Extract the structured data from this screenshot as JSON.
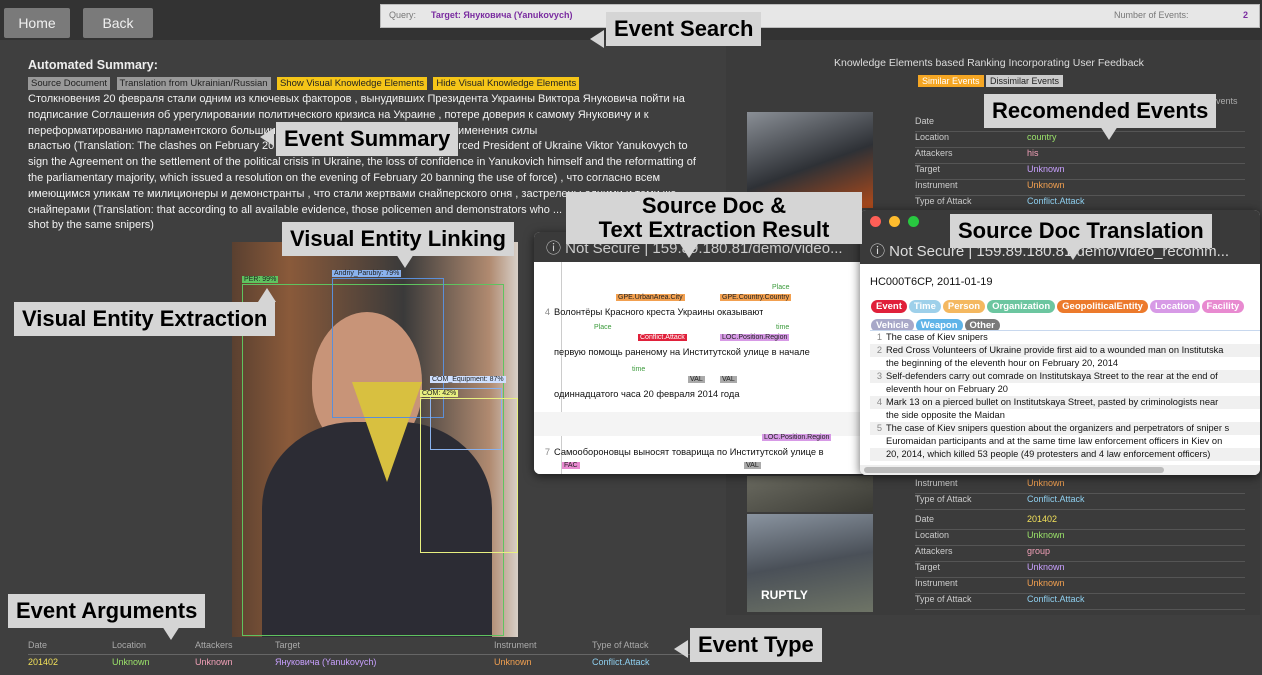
{
  "nav": {
    "home": "Home",
    "back": "Back"
  },
  "query": {
    "label": "Query:",
    "target": "Target: Януковича (Yanukovych)",
    "num_label": "Number of Events:",
    "num_value": "2"
  },
  "callouts": {
    "event_search": "Event Search",
    "event_summary": "Event Summary",
    "recommended": "Recomended Events",
    "source_doc": "Source Doc &",
    "text_extraction": "Text Extraction Result",
    "source_translation": "Source Doc Translation",
    "visual_linking": "Visual Entity Linking",
    "visual_extraction": "Visual Entity Extraction",
    "event_arguments": "Event Arguments",
    "event_type": "Event Type"
  },
  "summary": {
    "heading": "Automated Summary:",
    "buttons": [
      "Source Document",
      "Translation from Ukrainian/Russian",
      "Show Visual Knowledge Elements",
      "Hide Visual Knowledge Elements"
    ],
    "lines": [
      "Столкновения 20 февраля стали одним из ключевых факторов , вынудивших Президента Украины Виктора Януковича пойти на",
      "подписание Соглашения об урегулировании политического кризиса на Украине , потере доверия к самому Януковичу и к",
      "переформатированию парламентского большинства ... постановление о запрете применения силы",
      "властью (Translation: The clashes on February 20 became one of the key factors that forced President of Ukraine Viktor Yanukovych to",
      "sign the Agreement on the settlement of the political crisis in Ukraine, the loss of confidence in Yanukovich himself and the reformatting of",
      "the parliamentary majority, which issued a resolution on the evening of February 20 banning the use of force) , что согласно всем",
      "имеющимся уликам те милиционеры и демонстранты , что стали жертвами снайперского огня , застрелены одними и теми же",
      "снайперами (Translation: that according to all available evidence, those policemen and demonstrators who ...",
      "shot by the same snipers)"
    ]
  },
  "photo_boxes": [
    {
      "label": "PER: 99%"
    },
    {
      "label": "Andriy_Parubiy: 79%"
    },
    {
      "label": "COM_Equipment: 87%"
    },
    {
      "label": "COM: 42%"
    }
  ],
  "args": {
    "headers": [
      "Date",
      "Location",
      "Attackers",
      "Target",
      "Instrument",
      "Type of Attack"
    ],
    "values": [
      "201402",
      "Unknown",
      "Unknown",
      "Януковича (Yanukovych)",
      "Unknown",
      "Conflict.Attack"
    ]
  },
  "recommend": {
    "title": "Knowledge Elements based Ranking Incorporating User Feedback",
    "tabs": [
      "Similar Events",
      "Dissimilar Events"
    ],
    "tab_hint": "Events",
    "thumb_caption": "RUPTLY",
    "rows": [
      {
        "Date": "",
        "Location": "country",
        "Attackers": "his",
        "Target": "Unknown",
        "Instrument": "Unknown",
        "Type of Attack": "Conflict.Attack"
      },
      {
        "Instrument": "Unknown",
        "Type of Attack": "Conflict.Attack"
      },
      {
        "Date": "201402",
        "Location": "Unknown",
        "Attackers": "group",
        "Target": "Unknown",
        "Instrument": "Unknown",
        "Type of Attack": "Conflict.Attack"
      }
    ],
    "keys": [
      "Date",
      "Location",
      "Attackers",
      "Target",
      "Instrument",
      "Type of Attack"
    ]
  },
  "source_win": {
    "url_prefix": "ⓘ  Not Secure  |  159.89.180.81/demo/video...",
    "lines": [
      {
        "n": "4",
        "text": "Волонтёры      Красного      креста      Украины      оказывают"
      },
      {
        "n": "",
        "text": "первую помощь  раненому  на Институтской улице в начале"
      },
      {
        "n": "",
        "text": "одиннадцатого часа 20 февраля 2014 года"
      },
      {
        "n": "7",
        "text": "Самообороновцы выносят товарища по Институтской улице в"
      }
    ],
    "tags": [
      "GPE.UrbanArea.City",
      "GPE.Country.Country",
      "Place",
      "Conflict.Attack",
      "Place",
      "LOC.Position.Region",
      "time",
      "time",
      "VAL",
      "VAL",
      "LOC.Position.Region",
      "FAC",
      "VAL"
    ]
  },
  "trans_win": {
    "url": "ⓘ  Not Secure  |  159.89.180.81/demo/video_recomm...",
    "doc_id": "HC000T6CP,   2011-01-19",
    "chips": [
      {
        "label": "Event",
        "color": "#e0203a"
      },
      {
        "label": "Time",
        "color": "#9ed0ea"
      },
      {
        "label": "Person",
        "color": "#f4b860"
      },
      {
        "label": "Organization",
        "color": "#6cc6a0"
      },
      {
        "label": "GeopoliticalEntity",
        "color": "#ec7a2c"
      },
      {
        "label": "Location",
        "color": "#d79ae6"
      },
      {
        "label": "Facility",
        "color": "#e88ad0"
      },
      {
        "label": "Vehicle",
        "color": "#a8a8c8"
      },
      {
        "label": "Weapon",
        "color": "#5fb4e8"
      },
      {
        "label": "Other",
        "color": "#7a7a7a"
      }
    ],
    "lines": [
      {
        "n": "1",
        "text": "The case of Kiev snipers"
      },
      {
        "n": "2",
        "text": "Red Cross Volunteers of Ukraine provide first aid to a wounded man on Institutska"
      },
      {
        "n": "",
        "text": "the beginning of the eleventh hour on February 20, 2014"
      },
      {
        "n": "3",
        "text": "Self-defenders carry out comrade on Institutskaya Street to the rear at the end of"
      },
      {
        "n": "",
        "text": "eleventh hour on February 20"
      },
      {
        "n": "4",
        "text": "Mark 13 on a pierced bullet on Institutskaya Street, pasted by criminologists near"
      },
      {
        "n": "",
        "text": "the side opposite the Maidan"
      },
      {
        "n": "5",
        "text": "The case of Kiev snipers question about the organizers and perpetrators of sniper s"
      },
      {
        "n": "",
        "text": "Euromaidan participants and at the same time law enforcement officers in Kiev on"
      },
      {
        "n": "",
        "text": "20, 2014, which killed 53 people (49 protesters and 4 law enforcement officers)"
      }
    ]
  },
  "colors": {
    "date": "#f2e15a",
    "unknown_green": "#9be36a",
    "unknown_pink": "#f2a0b8",
    "target": "#c8a0ff",
    "instrument": "#f2a050",
    "type": "#8fd0f0",
    "location": "#9be36a"
  }
}
